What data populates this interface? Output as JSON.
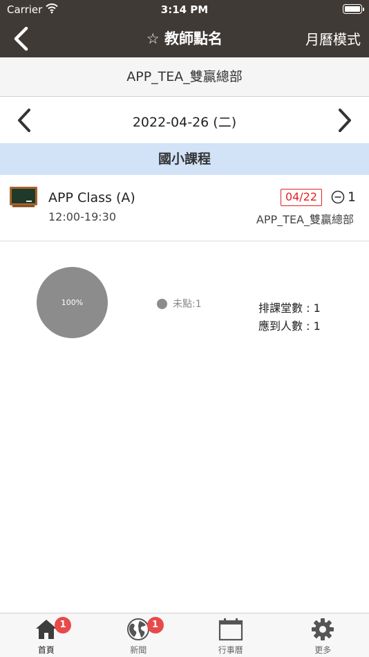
{
  "status_bar": {
    "carrier": "Carrier",
    "time": "3:14 PM"
  },
  "nav": {
    "title": "☆ 教師點名",
    "mode_label": "月曆模式"
  },
  "branch": {
    "name": "APP_TEA_雙贏總部"
  },
  "date_bar": {
    "date": "2022-04-26 (二)"
  },
  "section": {
    "title": "國小課程"
  },
  "course": {
    "name": "APP Class (A)",
    "time": "12:00-19:30",
    "badge": "04/22",
    "count": "1",
    "location": "APP_TEA_雙贏總部"
  },
  "chart_data": {
    "type": "pie",
    "slices": [
      {
        "name": "未點",
        "value": 1,
        "percent": 100,
        "color": "#8c8c8c"
      }
    ],
    "slice_label": "100%",
    "legend": [
      "未點:1"
    ]
  },
  "stats": {
    "scheduled": "排課堂數 : 1",
    "expected": "應到人數 : 1"
  },
  "tabbar": {
    "items": [
      {
        "label": "首頁",
        "icon": "home-icon",
        "badge": "1"
      },
      {
        "label": "新聞",
        "icon": "globe-icon",
        "badge": "1"
      },
      {
        "label": "行事曆",
        "icon": "calendar-icon"
      },
      {
        "label": "更多",
        "icon": "gear-icon"
      }
    ]
  }
}
